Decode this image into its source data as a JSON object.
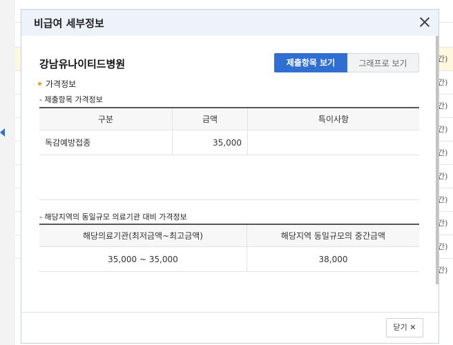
{
  "modal": {
    "title": "비급여 세부정보",
    "hospital_name": "강남유나이티드병원",
    "buttons": {
      "submitted_items": "제출항목 보기",
      "graph": "그래프로 보기"
    },
    "section_label": "가격정보",
    "table1": {
      "title": "- 제출항목 가격정보",
      "headers": [
        "구분",
        "금액",
        "특이사항"
      ],
      "rows": [
        {
          "category": "독감예방접종",
          "price": "35,000",
          "note": ""
        }
      ]
    },
    "table2": {
      "title": "- 해당지역의 동일규모 의료기관 대비 가격정보",
      "headers": [
        "해당의료기관(최저금액~최고금액)",
        "해당지역 동일규모의 중간금액"
      ],
      "rows": [
        {
          "range": "35,000 ~ 35,000",
          "median": "38,000"
        }
      ]
    },
    "footer": {
      "close_label": "닫기 ✕"
    }
  },
  "colors": {
    "accent": "#2f6fd1",
    "bullet": "#f0a500",
    "header_bg": "#eef3fb"
  }
}
